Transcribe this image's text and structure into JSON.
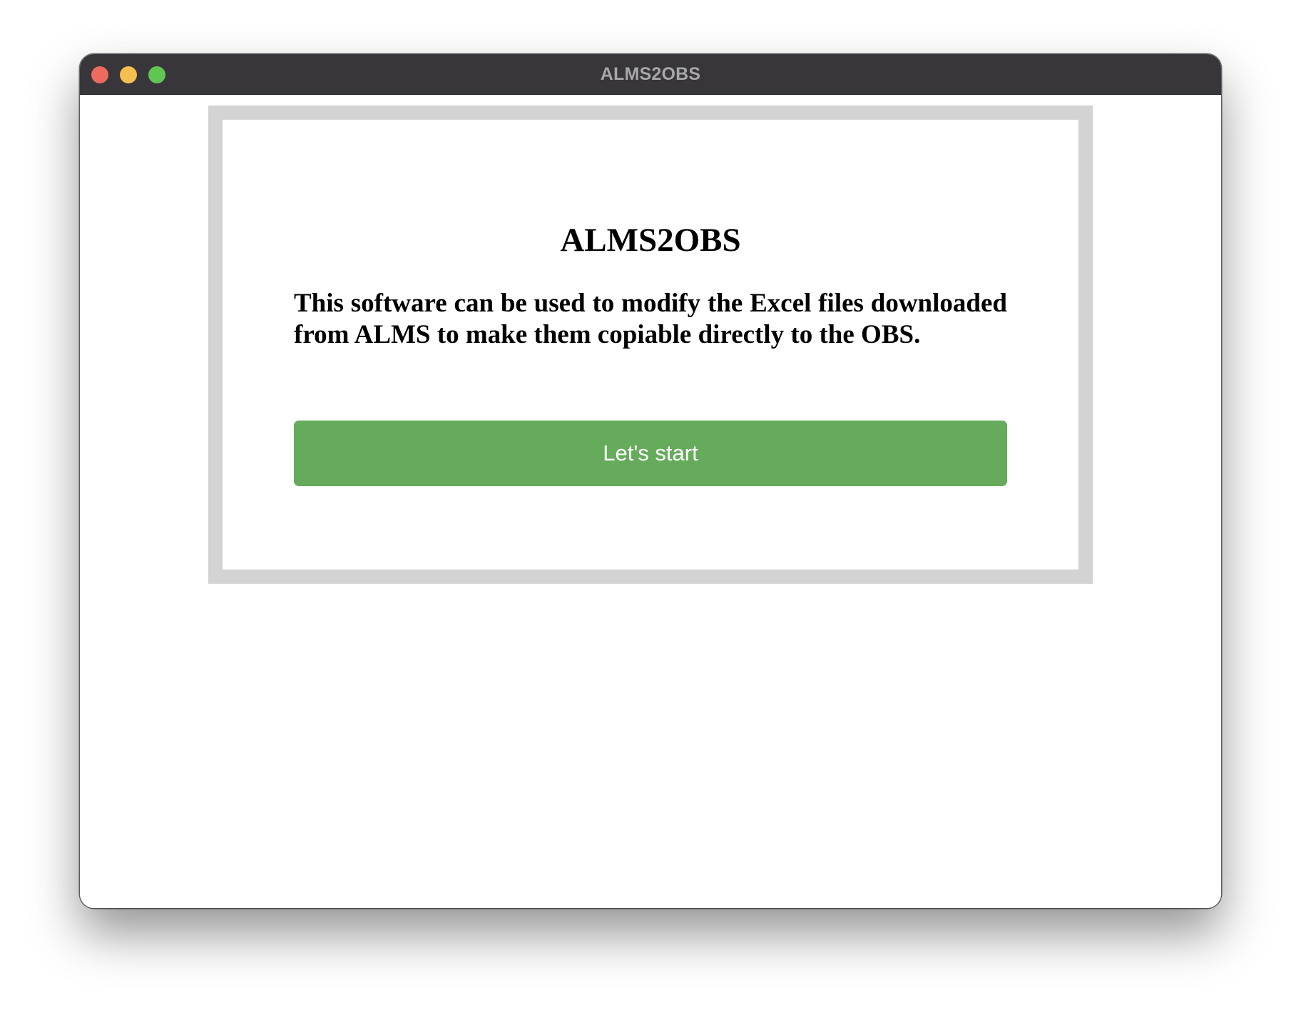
{
  "window": {
    "title": "ALMS2OBS",
    "controls": {
      "close_color": "#ec6a5e",
      "minimize_color": "#f4bf4f",
      "zoom_color": "#61c554"
    }
  },
  "main": {
    "heading": "ALMS2OBS",
    "description": "This software can be used to modify the Excel files downloaded from ALMS to make them copiable directly to the OBS.",
    "start_button": {
      "label": "Let's start",
      "color": "#66ab5c"
    }
  }
}
